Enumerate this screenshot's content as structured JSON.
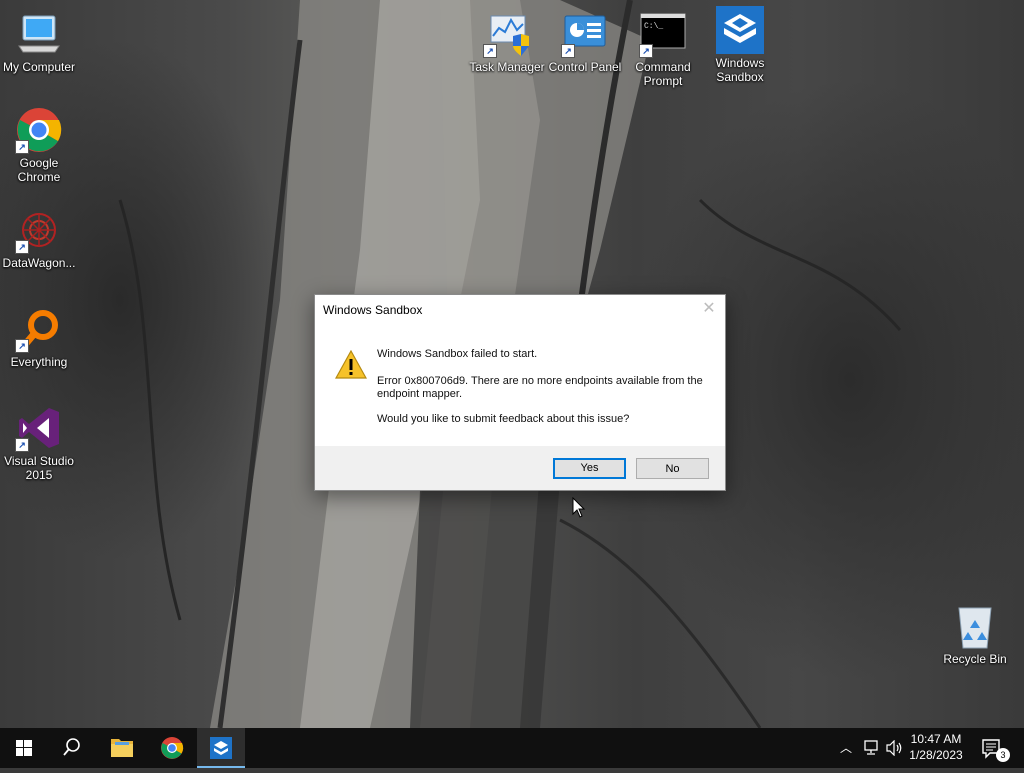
{
  "desktop": {
    "icons": [
      {
        "label": "My Computer"
      },
      {
        "label": "Google Chrome"
      },
      {
        "label": "DataWagon..."
      },
      {
        "label": "Everything"
      },
      {
        "label": "Visual Studio 2015"
      },
      {
        "label": "Task Manager"
      },
      {
        "label": "Control Panel"
      },
      {
        "label": "Command Prompt"
      },
      {
        "label": "Windows Sandbox"
      },
      {
        "label": "Recycle Bin"
      }
    ]
  },
  "dialog": {
    "title": "Windows Sandbox",
    "message_main": "Windows Sandbox failed to start.",
    "message_error": "Error 0x800706d9. There are no more endpoints available from the endpoint mapper.",
    "message_question": "Would you like to submit feedback about this issue?",
    "yes_label": "Yes",
    "no_label": "No",
    "close_glyph": "✕"
  },
  "taskbar": {
    "apps": [
      "start-button",
      "search",
      "file-explorer",
      "google-chrome",
      "windows-sandbox"
    ],
    "time": "10:47 AM",
    "date": "1/28/2023",
    "notification_count": "3",
    "accent": "#76b9ed"
  }
}
